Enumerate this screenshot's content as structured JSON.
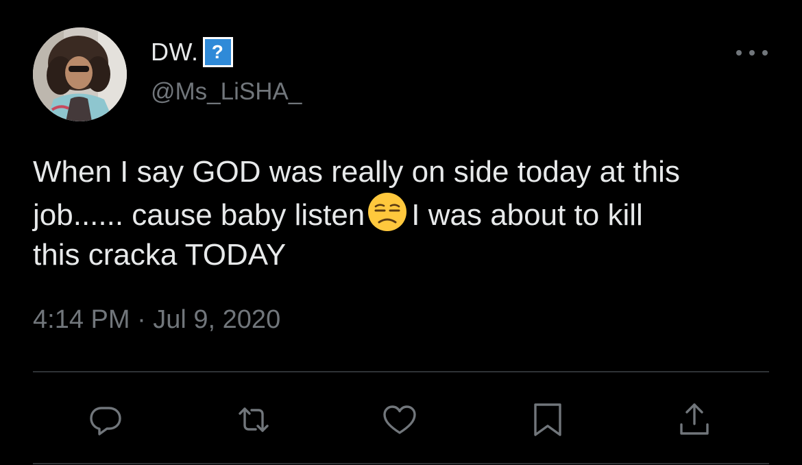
{
  "tweet": {
    "author": {
      "display_name": "DW.",
      "badge_glyph": "?",
      "handle": "@Ms_LiSHA_"
    },
    "text": {
      "before_emoji": "When I say GOD was really on side today at this\njob...... cause baby listen",
      "emoji": "unamused-face",
      "after_emoji": "I was about to kill\nthis cracka TODAY"
    },
    "timestamp": "4:14 PM · Jul 9, 2020",
    "actions": [
      "reply-icon",
      "retweet-icon",
      "like-icon",
      "bookmark-icon",
      "share-icon"
    ]
  },
  "colors": {
    "background": "#000000",
    "primary_text": "#e7e9ea",
    "secondary_text": "#71767b",
    "divider": "#2f3336",
    "badge_blue": "#2f8ad8"
  }
}
